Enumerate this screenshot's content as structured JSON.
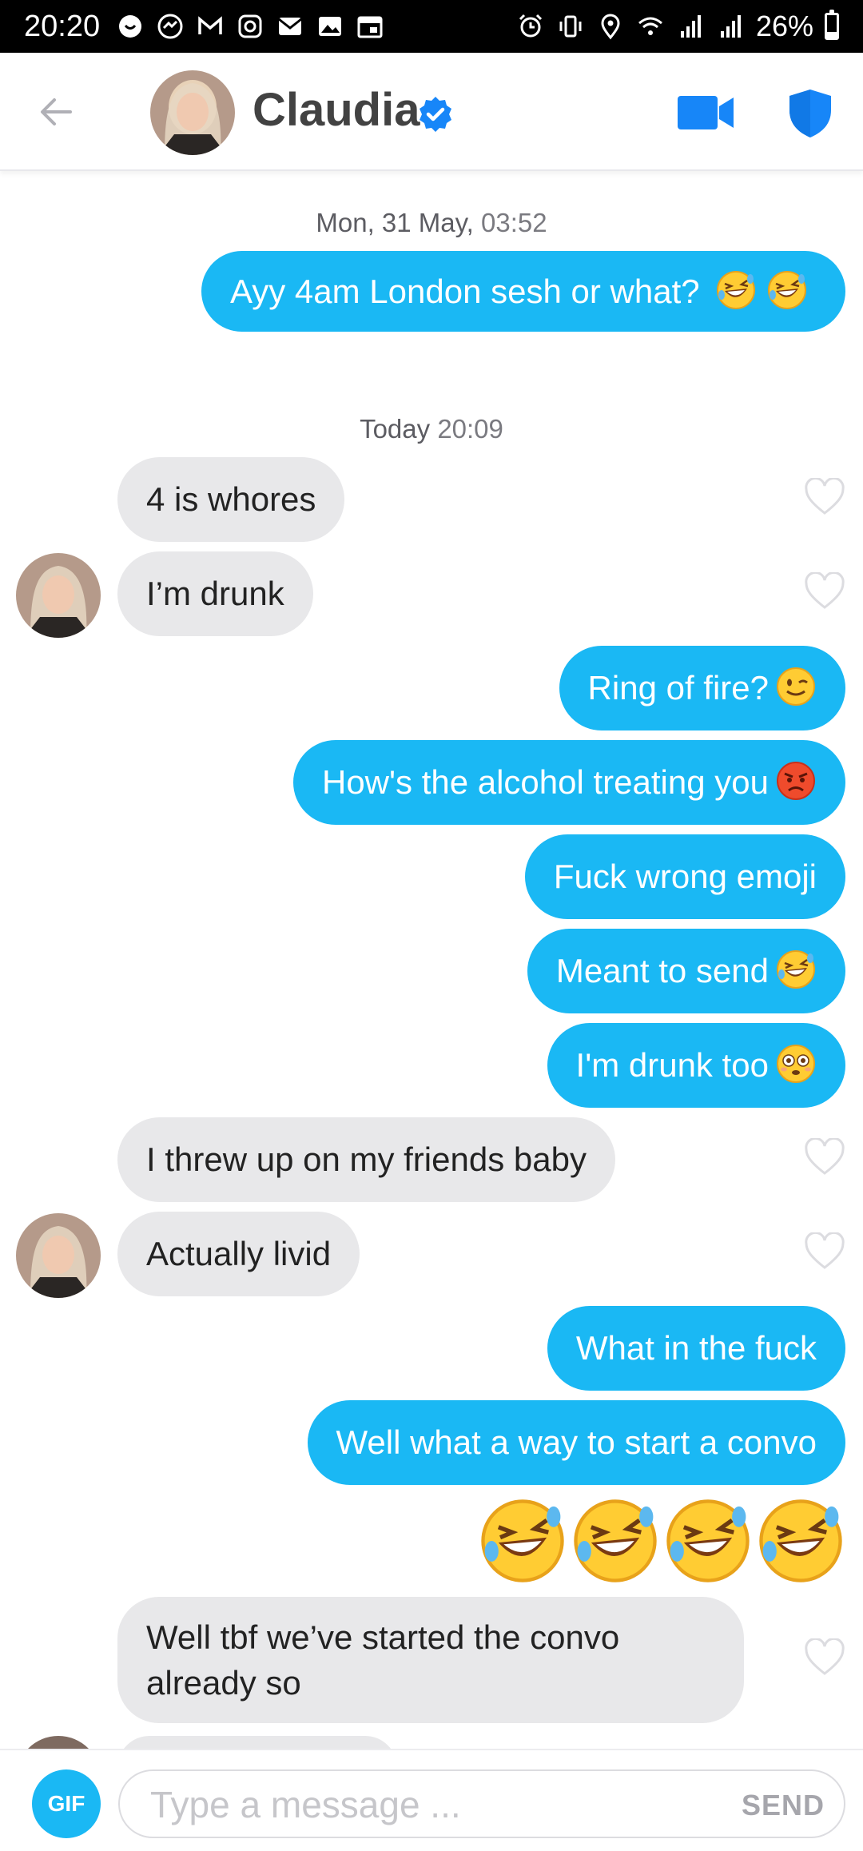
{
  "status_bar": {
    "time": "20:20",
    "battery": "26%",
    "battery_level": 0.26,
    "left_icons": [
      "whatsapp-icon",
      "messenger-icon",
      "gmail-icon",
      "instagram-icon",
      "email-icon",
      "gallery-icon",
      "calendar-icon"
    ],
    "right_icons": [
      "alarm-icon",
      "vibrate-icon",
      "location-icon",
      "wifi-icon",
      "signal-icon",
      "signal-icon"
    ]
  },
  "header": {
    "name": "Claudia",
    "verified": true,
    "icons": {
      "back": "arrow-left-icon",
      "video": "video-camera-icon",
      "safety": "shield-icon",
      "verified": "verified-badge-icon"
    }
  },
  "chat": {
    "timestamp_1": {
      "day": "Mon, 31 May,",
      "time": "03:52"
    },
    "timestamp_2": {
      "day": "Today",
      "time": "20:09"
    },
    "messages": [
      {
        "from": "me",
        "text": "Ayy 4am London sesh or what?",
        "emoji": [
          "rofl",
          "rofl"
        ]
      },
      {
        "from": "them",
        "text": "4 is whores",
        "liked": false
      },
      {
        "from": "them",
        "text": "I’m drunk",
        "liked": false
      },
      {
        "from": "me",
        "text": "Ring of fire?",
        "emoji": [
          "wink"
        ]
      },
      {
        "from": "me",
        "text": "How's the alcohol treating you",
        "emoji": [
          "angry"
        ]
      },
      {
        "from": "me",
        "text": "Fuck wrong emoji"
      },
      {
        "from": "me",
        "text": "Meant to send",
        "emoji": [
          "rofl"
        ]
      },
      {
        "from": "me",
        "text": "I'm drunk too",
        "emoji": [
          "flushed"
        ]
      },
      {
        "from": "them",
        "text": "I threw up on my friends baby",
        "liked": false
      },
      {
        "from": "them",
        "text": "Actually livid",
        "liked": false
      },
      {
        "from": "me",
        "text": "What in the fuck"
      },
      {
        "from": "me",
        "text": "Well what a way to start a convo"
      },
      {
        "from": "me",
        "text": "",
        "emoji": [
          "rofl",
          "rofl",
          "rofl",
          "rofl"
        ]
      },
      {
        "from": "them",
        "text": "Well tbf we’ve started the convo already so",
        "liked": false
      }
    ]
  },
  "composer": {
    "gif_label": "GIF",
    "placeholder": "Type a message ...",
    "value": "",
    "send_label": "SEND"
  },
  "colors": {
    "sent_bubble": "#1ab8f4",
    "received_bubble": "#e8e8ea",
    "accent": "#1ab8f4",
    "verified_badge": "#1786f8"
  }
}
